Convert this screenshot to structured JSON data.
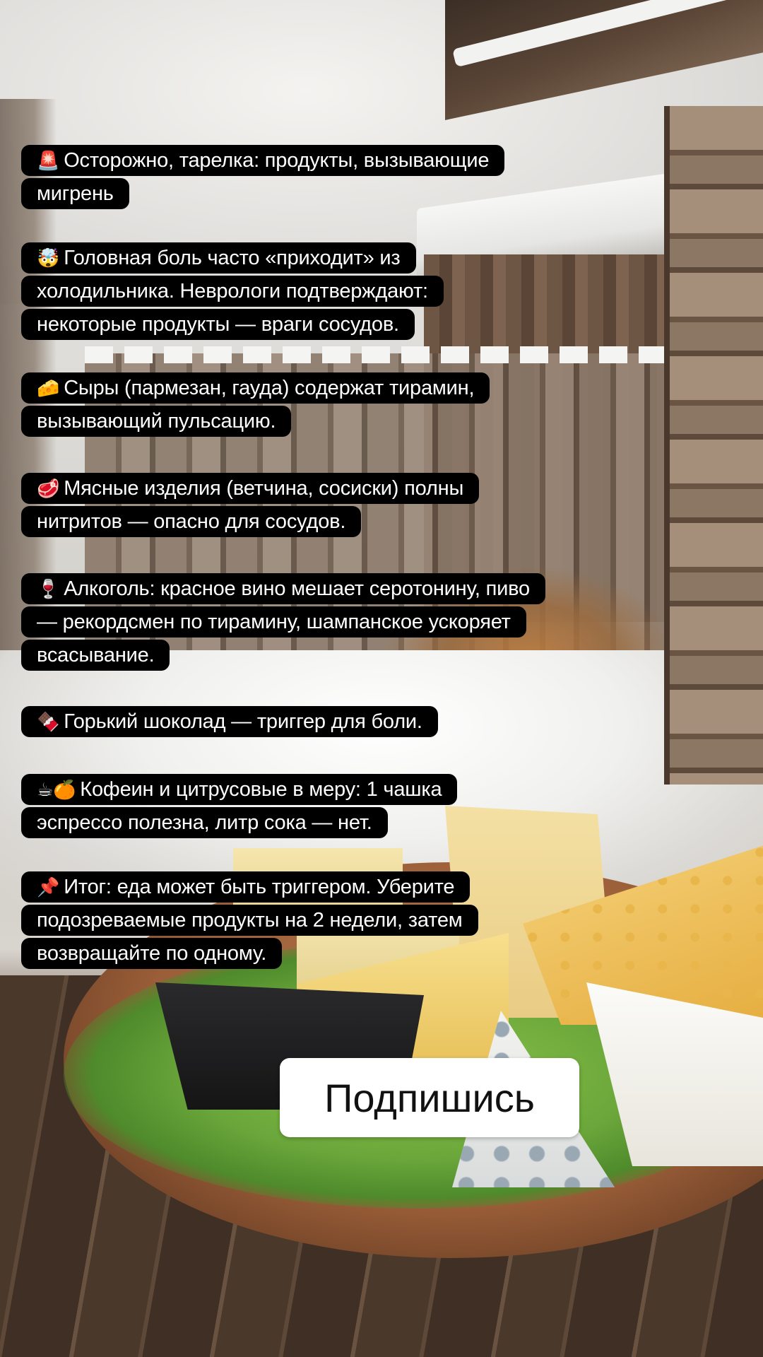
{
  "captions": [
    {
      "emoji": "🚨",
      "emoji_name": "rotating-light-icon",
      "text": "Осторожно, тарелка: продукты, вызывающие мигрень"
    },
    {
      "emoji": "🤯",
      "emoji_name": "exploding-head-icon",
      "text": "Головная боль часто «приходит» из холодильника. Неврологи подтверждают: некоторые продукты — враги сосудов."
    },
    {
      "emoji": "🧀",
      "emoji_name": "cheese-icon",
      "text": "Сыры (пармезан, гауда) содержат тирамин, вызывающий пульсацию."
    },
    {
      "emoji": "🥩",
      "emoji_name": "meat-icon",
      "text": "Мясные изделия (ветчина, сосиски) полны нитритов — опасно для сосудов."
    },
    {
      "emoji": "🍷",
      "emoji_name": "wine-glass-icon",
      "text": "Алкоголь: красное вино мешает серотонину, пиво — рекордсмен по тирамину, шампанское ускоряет всасывание."
    },
    {
      "emoji": "🍫",
      "emoji_name": "chocolate-icon",
      "text": "Горький шоколад — триггер для боли."
    },
    {
      "emoji": "☕🍊",
      "emoji_name": "coffee-orange-icon",
      "text": "Кофеин и цитрусовые в меру: 1 чашка эспрессо полезна, литр сока — нет."
    },
    {
      "emoji": "📌",
      "emoji_name": "pushpin-icon",
      "text": "Итог: еда может быть триггером. Уберите подозреваемые продукты на 2 недели, затем возвращайте по одному."
    }
  ],
  "subscribe_button": {
    "label": "Подпишись"
  }
}
